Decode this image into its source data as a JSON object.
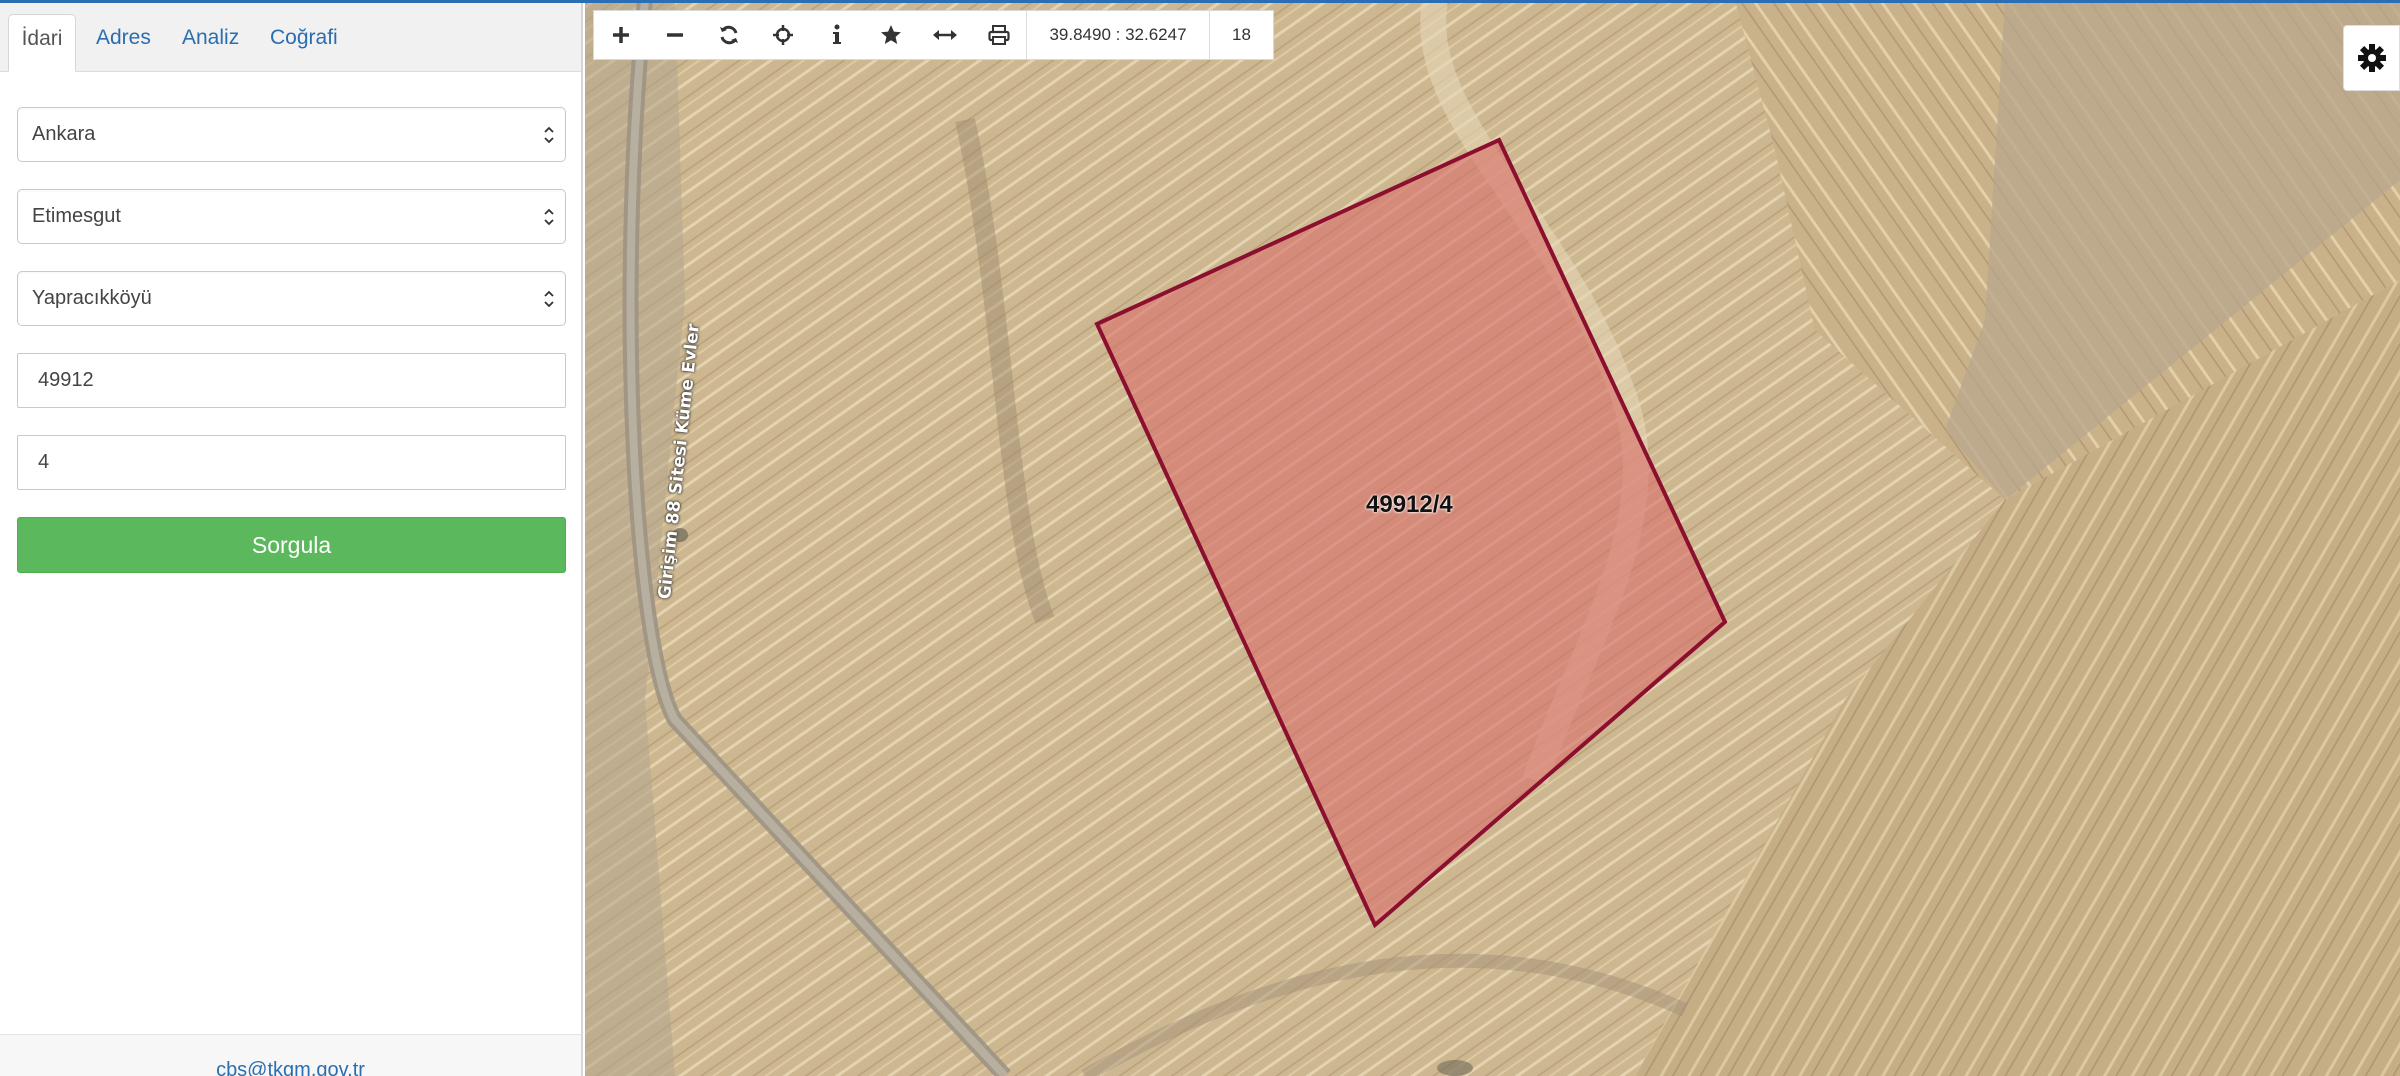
{
  "tabs": [
    {
      "label": "İdari"
    },
    {
      "label": "Adres"
    },
    {
      "label": "Analiz"
    },
    {
      "label": "Coğrafi"
    }
  ],
  "form": {
    "province": "Ankara",
    "district": "Etimesgut",
    "neighborhood": "Yapracıkköyü",
    "block": "49912",
    "parcel": "4",
    "submit_label": "Sorgula"
  },
  "footer": {
    "email": "cbs@tkgm.gov.tr"
  },
  "toolbar": {
    "icons": [
      "plus-icon",
      "minus-icon",
      "refresh-icon",
      "crosshair-icon",
      "info-icon",
      "star-icon",
      "measure-icon",
      "print-icon"
    ],
    "coordinates": "39.8490 : 32.6247",
    "zoom": "18"
  },
  "map": {
    "road_label": "Girişim 88 Sitesi Küme Evler",
    "parcel_label": "49912/4",
    "parcel_fill": "#d9706a",
    "parcel_stroke": "#8b0f2e"
  },
  "colors": {
    "accent": "#2a6eb0",
    "primary_button": "#5cb85c"
  }
}
